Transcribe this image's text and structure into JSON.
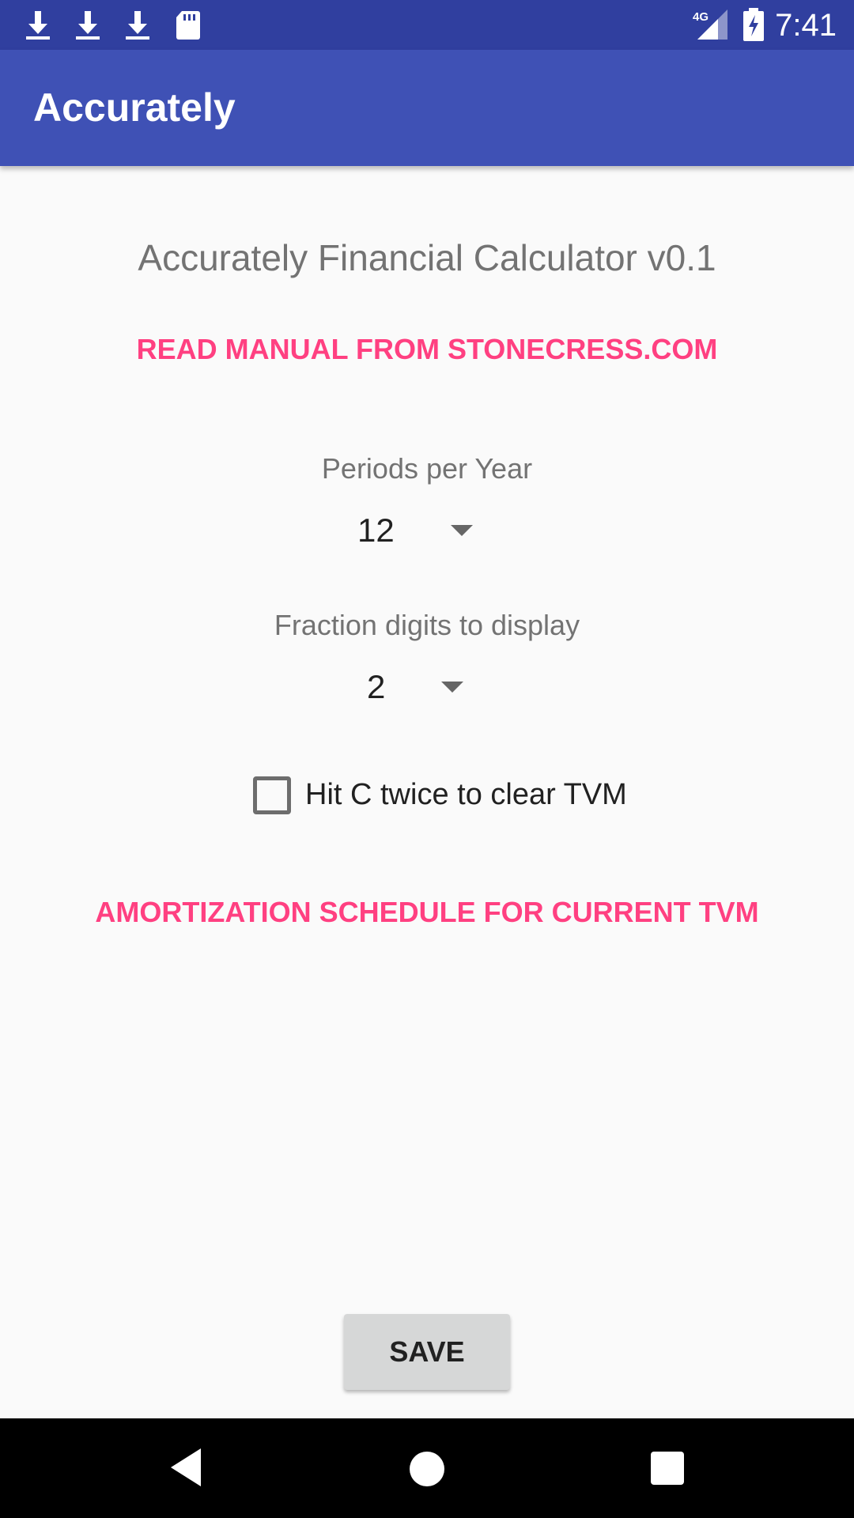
{
  "status_bar": {
    "time": "7:41",
    "network": "4G",
    "left_icons": [
      "download-icon",
      "download-icon",
      "download-icon",
      "sd-card-icon"
    ],
    "right_icons": [
      "signal-icon",
      "battery-charging-icon"
    ]
  },
  "app_bar": {
    "title": "Accurately",
    "color": "#3f51b5"
  },
  "main": {
    "heading": "Accurately Financial Calculator v0.1",
    "manual_link": "READ MANUAL FROM STONECRESS.COM",
    "periods_label": "Periods per Year",
    "periods_value": "12",
    "fraction_label": "Fraction digits to display",
    "fraction_value": "2",
    "clear_checkbox_label": "Hit C twice to clear TVM",
    "clear_checkbox_checked": false,
    "amortization_link": "AMORTIZATION SCHEDULE FOR CURRENT TVM",
    "accent_color": "#ff4081"
  },
  "save_button": {
    "label": "SAVE"
  },
  "nav_bar": {
    "icons": [
      "back-icon",
      "home-icon",
      "recents-icon"
    ]
  }
}
